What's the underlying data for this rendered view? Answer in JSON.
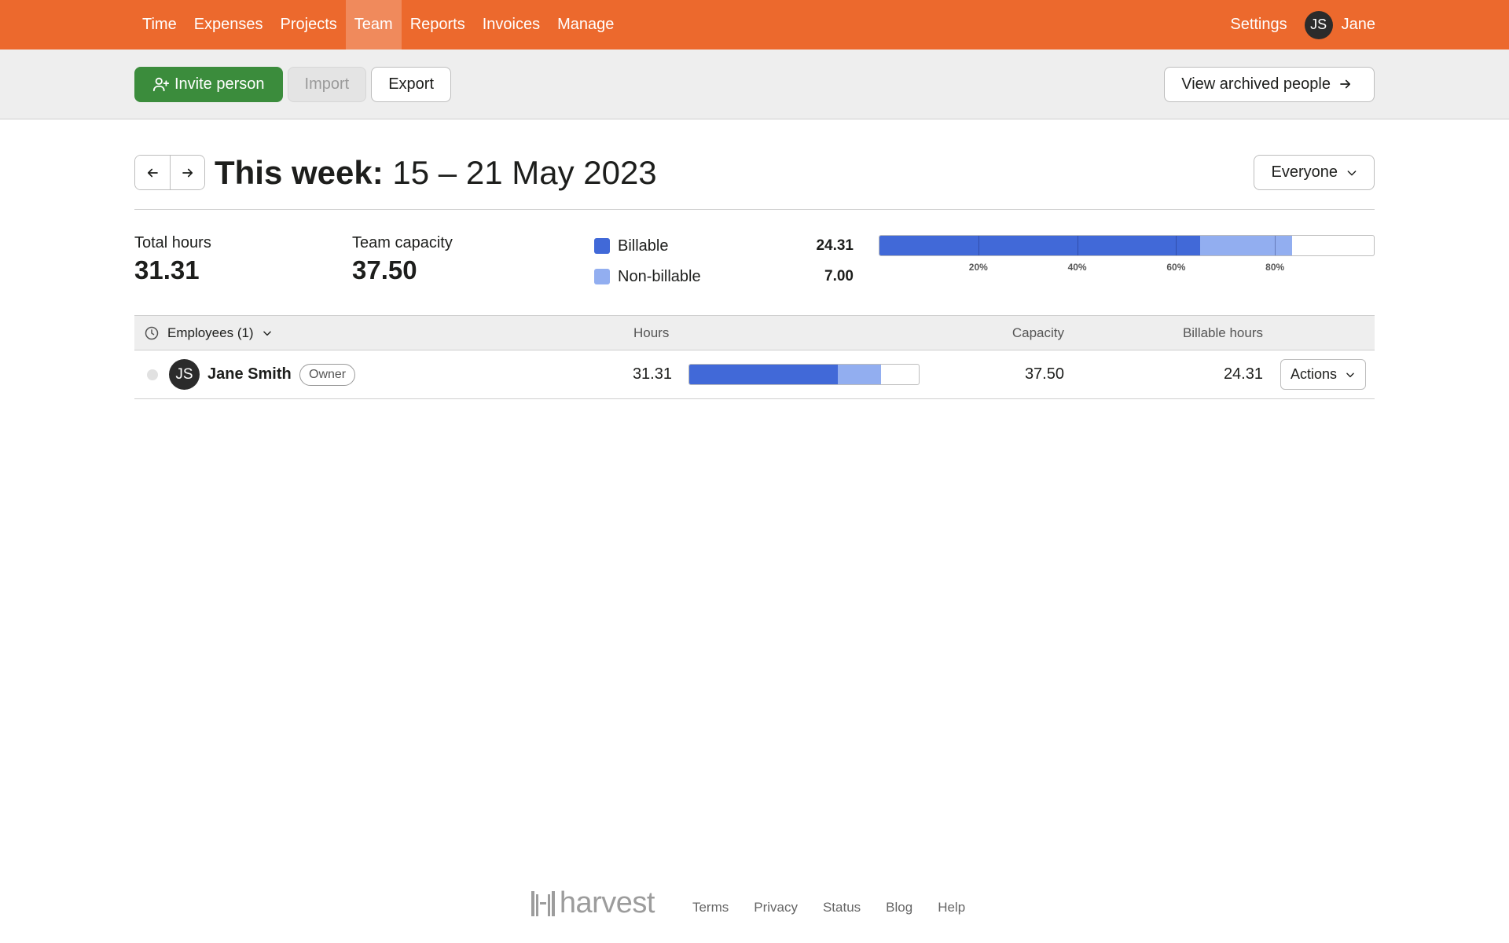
{
  "nav": {
    "items": [
      {
        "label": "Time"
      },
      {
        "label": "Expenses"
      },
      {
        "label": "Projects"
      },
      {
        "label": "Team",
        "active": true
      },
      {
        "label": "Reports"
      },
      {
        "label": "Invoices"
      },
      {
        "label": "Manage"
      }
    ],
    "settings": "Settings",
    "user_initials": "JS",
    "user_name": "Jane"
  },
  "toolbar": {
    "invite": "Invite person",
    "import": "Import",
    "export": "Export",
    "archived": "View archived people"
  },
  "week": {
    "prefix": "This week:",
    "range": "15 – 21 May 2023",
    "filter": "Everyone"
  },
  "summary": {
    "total_hours_label": "Total hours",
    "total_hours": "31.31",
    "capacity_label": "Team capacity",
    "capacity": "37.50",
    "billable_label": "Billable",
    "billable": "24.31",
    "nonbillable_label": "Non-billable",
    "nonbillable": "7.00",
    "bar": {
      "billable_fraction": 0.6483,
      "nonbillable_fraction": 0.1867,
      "ticks": [
        "20%",
        "40%",
        "60%",
        "80%"
      ],
      "tick_values": [
        0.2,
        0.4,
        0.6,
        0.8
      ]
    }
  },
  "table": {
    "group": "Employees (1)",
    "headers": {
      "hours": "Hours",
      "capacity": "Capacity",
      "billable_hours": "Billable hours"
    },
    "rows": [
      {
        "initials": "JS",
        "name": "Jane Smith",
        "badge": "Owner",
        "hours": "31.31",
        "capacity": "37.50",
        "billable_hours": "24.31",
        "actions": "Actions",
        "billable_fraction": 0.6483,
        "nonbillable_fraction": 0.1867
      }
    ]
  },
  "footer": {
    "logo": "harvest",
    "links": [
      "Terms",
      "Privacy",
      "Status",
      "Blog",
      "Help"
    ]
  },
  "colors": {
    "nav_bg": "#ec692d",
    "nav_active": "#f08a5c",
    "invite_green": "#3b8c3c",
    "billable": "#4169d8",
    "nonbillable": "#92aef0"
  }
}
